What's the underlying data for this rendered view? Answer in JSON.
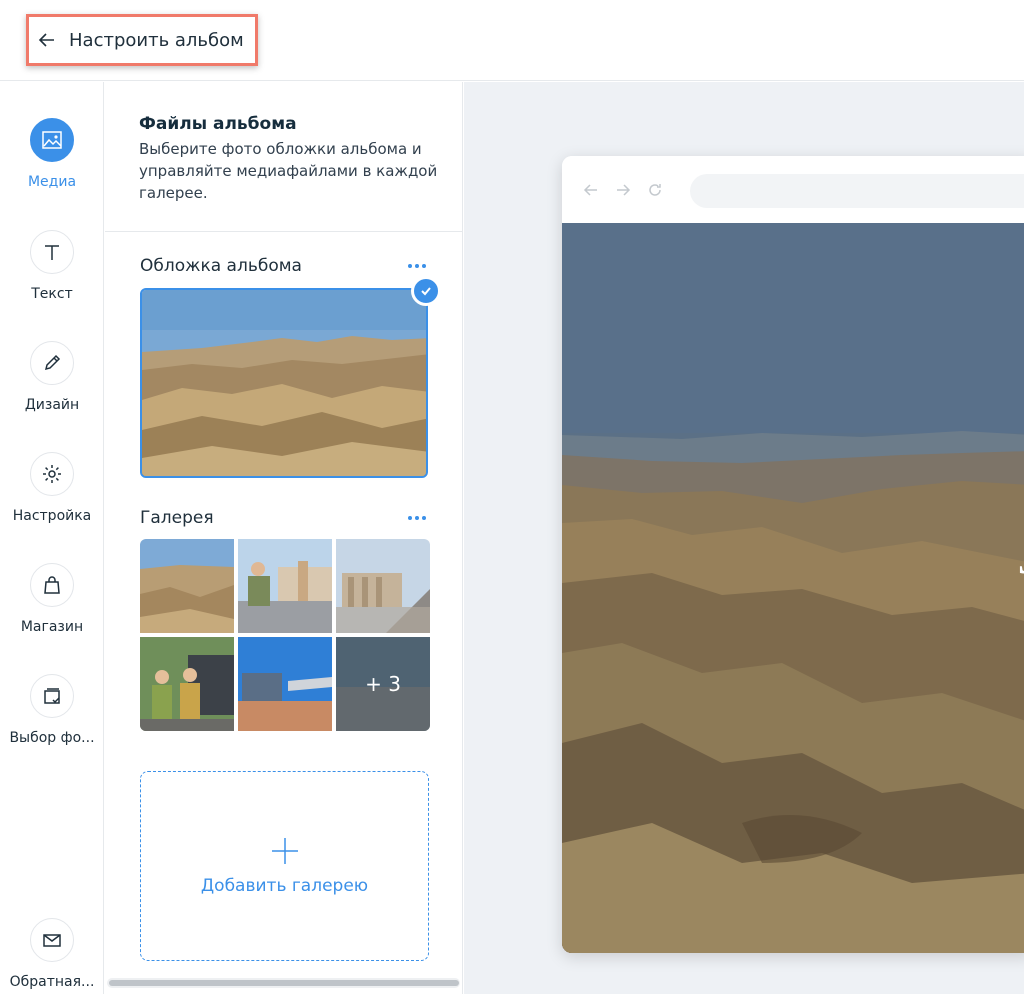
{
  "header": {
    "back_label": "Настроить альбом"
  },
  "rail": {
    "items": [
      {
        "label": "Медиа",
        "icon": "image-icon",
        "active": true
      },
      {
        "label": "Текст",
        "icon": "text-icon",
        "active": false
      },
      {
        "label": "Дизайн",
        "icon": "pen-icon",
        "active": false
      },
      {
        "label": "Настройка",
        "icon": "gear-icon",
        "active": false
      },
      {
        "label": "Магазин",
        "icon": "shopping-bag-icon",
        "active": false
      },
      {
        "label": "Выбор фо...",
        "icon": "photo-select-icon",
        "active": false
      },
      {
        "label": "Обратная...",
        "icon": "mail-icon",
        "active": false
      }
    ]
  },
  "panel": {
    "title": "Файлы альбома",
    "description": "Выберите фото обложки альбома и управляйте медиафайлами в каждой галерее.",
    "cover_label": "Обложка альбома",
    "gallery_label": "Галерея",
    "more_count": "+ 3",
    "add_gallery_label": "Добавить галерею"
  },
  "colors": {
    "accent": "#3b90e8",
    "highlight_border": "#f07a6a"
  },
  "preview": {
    "hero_letter": "J"
  }
}
